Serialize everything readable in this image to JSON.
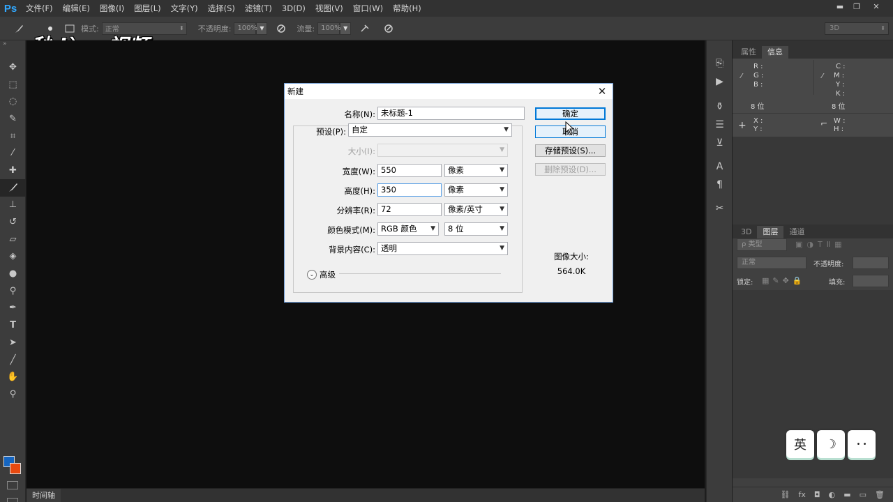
{
  "app": {
    "logo": "Ps"
  },
  "menubar": {
    "items": [
      "文件(F)",
      "编辑(E)",
      "图像(I)",
      "图层(L)",
      "文字(Y)",
      "选择(S)",
      "滤镜(T)",
      "3D(D)",
      "视图(V)",
      "窗口(W)",
      "帮助(H)"
    ]
  },
  "window_controls": {
    "minimize": "▬",
    "restore": "❐",
    "close": "✕"
  },
  "options_bar": {
    "mode_label": "模式:",
    "mode_value": "正常",
    "opacity_label": "不透明度:",
    "opacity_value": "100%",
    "flow_label": "流量:",
    "flow_value": "100%",
    "workspace": "3D"
  },
  "watermark": "秒dòng视频",
  "toolbar": {
    "tools": [
      "move-tool",
      "marquee-tool",
      "lasso-tool",
      "quick-select-tool",
      "crop-tool",
      "eyedropper-tool",
      "healing-brush-tool",
      "brush-tool",
      "clone-stamp-tool",
      "history-brush-tool",
      "eraser-tool",
      "paint-bucket-tool",
      "blur-tool",
      "dodge-tool",
      "pen-tool",
      "type-tool",
      "path-select-tool",
      "line-tool",
      "hand-tool",
      "zoom-tool"
    ],
    "active": "brush-tool",
    "fg_color": "#1565c0",
    "bg_color": "#e8490f"
  },
  "timeline": {
    "tab": "时间轴"
  },
  "info_panel": {
    "tabs": [
      "属性",
      "信息"
    ],
    "active_tab": "信息",
    "rgb_labels": [
      "R :",
      "G :",
      "B :"
    ],
    "cmyk_labels": [
      "C :",
      "M :",
      "Y :",
      "K :"
    ],
    "bit_left": "8 位",
    "bit_right": "8 位",
    "xy_labels": [
      "X :",
      "Y :"
    ],
    "wh_labels": [
      "W :",
      "H :"
    ]
  },
  "layers_panel": {
    "tabs": [
      "3D",
      "图层",
      "通道"
    ],
    "active_tab": "图层",
    "filter_label": "ρ 类型",
    "blend_mode": "正常",
    "opacity_label": "不透明度:",
    "lock_label": "锁定:",
    "fill_label": "填充:",
    "footer_icons": [
      "link-icon",
      "fx-icon",
      "mask-icon",
      "adjustment-icon",
      "group-icon",
      "new-layer-icon",
      "trash-icon"
    ]
  },
  "dialog": {
    "title": "新建",
    "name_label": "名称(N):",
    "name_value": "未标题-1",
    "preset_label": "预设(P):",
    "preset_value": "自定",
    "size_label": "大小(I):",
    "size_value": "",
    "width_label": "宽度(W):",
    "width_value": "550",
    "width_unit": "像素",
    "height_label": "高度(H):",
    "height_value": "350",
    "height_unit": "像素",
    "resolution_label": "分辨率(R):",
    "resolution_value": "72",
    "resolution_unit": "像素/英寸",
    "colormode_label": "颜色模式(M):",
    "colormode_value": "RGB 颜色",
    "bitdepth_value": "8 位",
    "background_label": "背景内容(C):",
    "background_value": "透明",
    "advanced_label": "高级",
    "ok_button": "确定",
    "cancel_button": "取消",
    "save_preset_button": "存储预设(S)...",
    "delete_preset_button": "删除预设(D)...",
    "image_size_label": "图像大小:",
    "image_size_value": "564.0K"
  },
  "ime_bar": {
    "lang": "英",
    "moon": "☽",
    "dots": "• •"
  }
}
